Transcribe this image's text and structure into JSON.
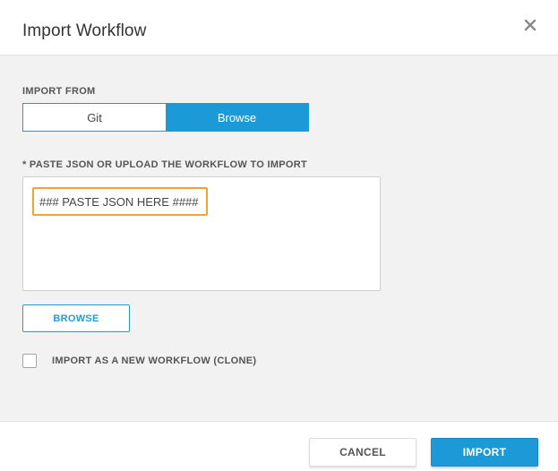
{
  "dialog": {
    "title": "Import Workflow",
    "close_icon": "close-icon"
  },
  "import_from": {
    "label": "IMPORT FROM",
    "options": [
      "Git",
      "Browse"
    ],
    "selected": "Browse"
  },
  "json_input": {
    "label": "* PASTE JSON OR UPLOAD THE WORKFLOW TO IMPORT",
    "value": "### PASTE JSON HERE ####"
  },
  "browse_button": {
    "label": "BROWSE"
  },
  "clone_checkbox": {
    "label": "IMPORT AS A NEW WORKFLOW (CLONE)",
    "checked": false
  },
  "footer": {
    "cancel_label": "CANCEL",
    "import_label": "IMPORT"
  },
  "colors": {
    "accent": "#1c9ad8",
    "highlight": "#f0a23a",
    "body_bg": "#f2f2f2"
  }
}
